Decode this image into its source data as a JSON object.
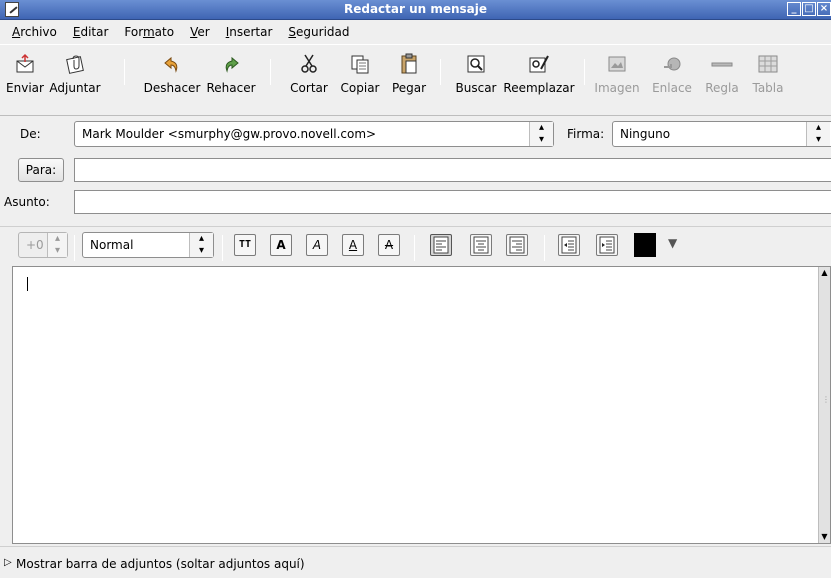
{
  "window": {
    "title": "Redactar un mensaje",
    "controls": [
      "minimize",
      "maximize",
      "close"
    ]
  },
  "menu": [
    {
      "label": "Archivo",
      "mnemonic_index": 0
    },
    {
      "label": "Editar",
      "mnemonic_index": 0
    },
    {
      "label": "Formato",
      "mnemonic_index": 3
    },
    {
      "label": "Ver",
      "mnemonic_index": 0
    },
    {
      "label": "Insertar",
      "mnemonic_index": 0
    },
    {
      "label": "Seguridad",
      "mnemonic_index": 0
    }
  ],
  "toolbar": {
    "enviar": "Enviar",
    "adjuntar": "Adjuntar",
    "deshacer": "Deshacer",
    "rehacer": "Rehacer",
    "cortar": "Cortar",
    "copiar": "Copiar",
    "pegar": "Pegar",
    "buscar": "Buscar",
    "reemplazar": "Reemplazar",
    "imagen": "Imagen",
    "enlace": "Enlace",
    "regla": "Regla",
    "tabla": "Tabla",
    "disabled": [
      "Imagen",
      "Enlace",
      "Regla",
      "Tabla"
    ]
  },
  "header": {
    "from_label": "De:",
    "from_value": "Mark Moulder <smurphy@gw.provo.novell.com>",
    "signature_label": "Firma:",
    "signature_value": "Ninguno",
    "to_button": "Para:",
    "to_value": "",
    "subject_label": "Asunto:",
    "subject_value": ""
  },
  "format": {
    "size_value": "+0",
    "paragraph_style": "Normal",
    "text_color": "#000000",
    "tt_label": "TT",
    "bold_label": "A",
    "italic_label": "A",
    "underline_label": "A",
    "strike_label": "A",
    "align_active": "left"
  },
  "attachments": {
    "expander_text": "Mostrar barra de adjuntos (soltar adjuntos aquí)"
  }
}
